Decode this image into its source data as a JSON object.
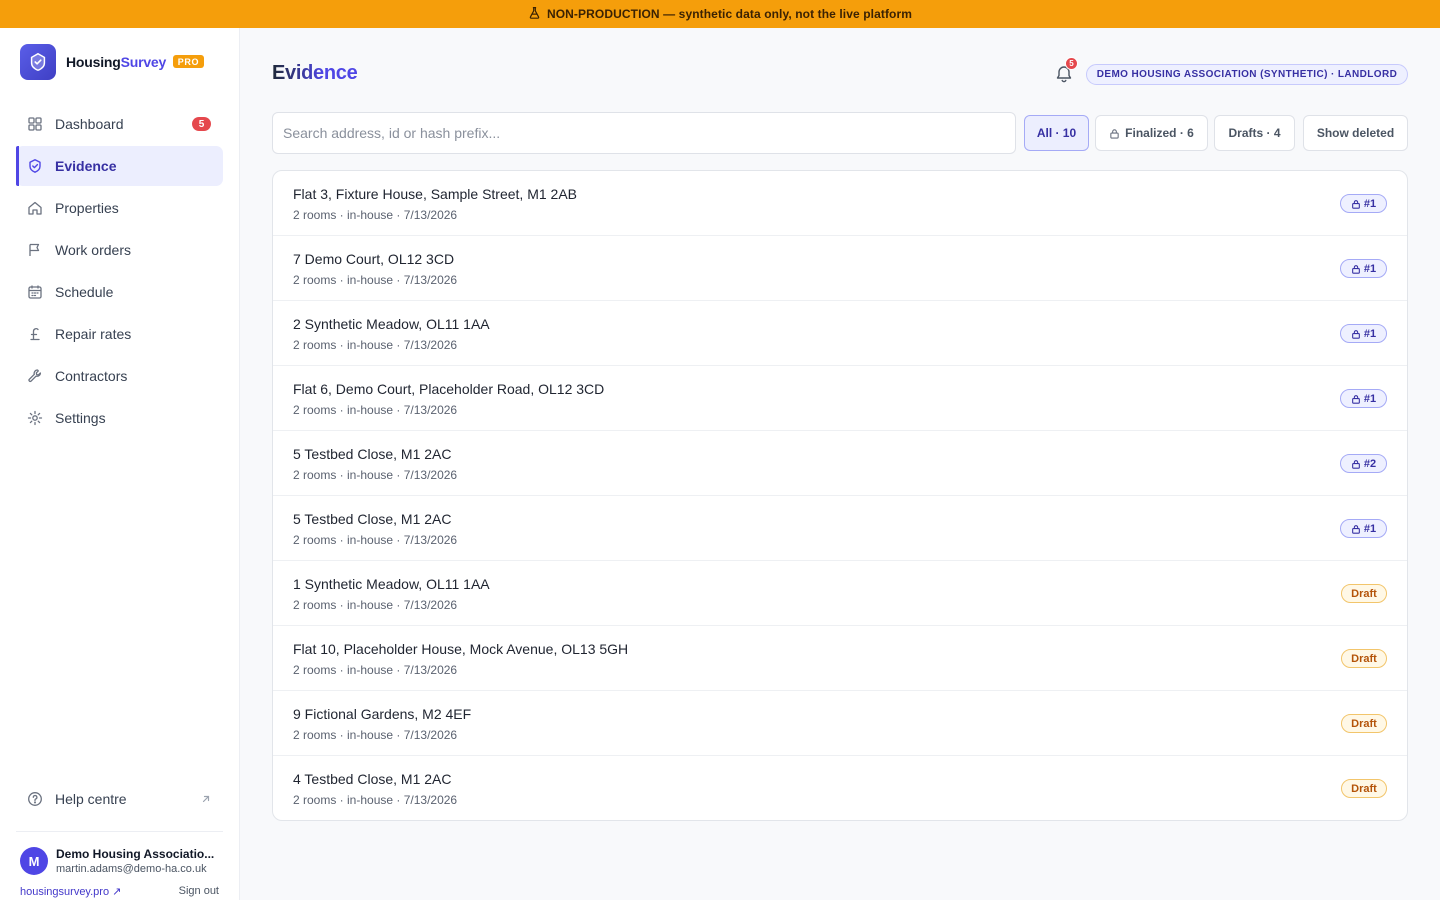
{
  "banner": {
    "text": "NON-PRODUCTION — synthetic data only, not the live platform"
  },
  "brand": {
    "name_part1": "Housing",
    "name_part2": "Survey",
    "badge": "PRO"
  },
  "sidebar": {
    "items": [
      {
        "key": "dashboard",
        "label": "Dashboard",
        "icon": "dashboard-grid-icon",
        "badge": "5"
      },
      {
        "key": "evidence",
        "label": "Evidence",
        "icon": "shield-check-icon",
        "active": true
      },
      {
        "key": "properties",
        "label": "Properties",
        "icon": "home-icon"
      },
      {
        "key": "work-orders",
        "label": "Work orders",
        "icon": "flag-icon"
      },
      {
        "key": "schedule",
        "label": "Schedule",
        "icon": "calendar-icon"
      },
      {
        "key": "repair-rates",
        "label": "Repair rates",
        "icon": "pound-sign-icon"
      },
      {
        "key": "contractors",
        "label": "Contractors",
        "icon": "wrench-icon"
      },
      {
        "key": "settings",
        "label": "Settings",
        "icon": "gear-icon"
      }
    ],
    "help_label": "Help centre",
    "user": {
      "initial": "M",
      "name": "Demo Housing Associatio...",
      "email": "martin.adams@demo-ha.co.uk"
    },
    "site_link": "housingsurvey.pro ↗",
    "sign_out": "Sign out"
  },
  "header": {
    "title": "Evidence",
    "notifications_count": "5",
    "org_label": "DEMO HOUSING ASSOCIATION (SYNTHETIC) · LANDLORD"
  },
  "search": {
    "placeholder": "Search address, id or hash prefix..."
  },
  "filters": {
    "all": "All · 10",
    "finalized": "Finalized · 6",
    "drafts": "Drafts · 4",
    "show_deleted": "Show deleted"
  },
  "colors": {
    "accent": "#4f46e5",
    "banner": "#f59e0b",
    "draft": "#b45309",
    "badge_red": "#e5484d"
  },
  "evidence": [
    {
      "address": "Flat 3, Fixture House, Sample Street, M1 2AB",
      "meta": "2 rooms · in-house · 7/13/2026",
      "status": "final",
      "tag": "#1"
    },
    {
      "address": "7 Demo Court, OL12 3CD",
      "meta": "2 rooms · in-house · 7/13/2026",
      "status": "final",
      "tag": "#1"
    },
    {
      "address": "2 Synthetic Meadow, OL11 1AA",
      "meta": "2 rooms · in-house · 7/13/2026",
      "status": "final",
      "tag": "#1"
    },
    {
      "address": "Flat 6, Demo Court, Placeholder Road, OL12 3CD",
      "meta": "2 rooms · in-house · 7/13/2026",
      "status": "final",
      "tag": "#1"
    },
    {
      "address": "5 Testbed Close, M1 2AC",
      "meta": "2 rooms · in-house · 7/13/2026",
      "status": "final",
      "tag": "#2"
    },
    {
      "address": "5 Testbed Close, M1 2AC",
      "meta": "2 rooms · in-house · 7/13/2026",
      "status": "final",
      "tag": "#1"
    },
    {
      "address": "1 Synthetic Meadow, OL11 1AA",
      "meta": "2 rooms · in-house · 7/13/2026",
      "status": "draft",
      "tag": "Draft"
    },
    {
      "address": "Flat 10, Placeholder House, Mock Avenue, OL13 5GH",
      "meta": "2 rooms · in-house · 7/13/2026",
      "status": "draft",
      "tag": "Draft"
    },
    {
      "address": "9 Fictional Gardens, M2 4EF",
      "meta": "2 rooms · in-house · 7/13/2026",
      "status": "draft",
      "tag": "Draft"
    },
    {
      "address": "4 Testbed Close, M1 2AC",
      "meta": "2 rooms · in-house · 7/13/2026",
      "status": "draft",
      "tag": "Draft"
    }
  ]
}
